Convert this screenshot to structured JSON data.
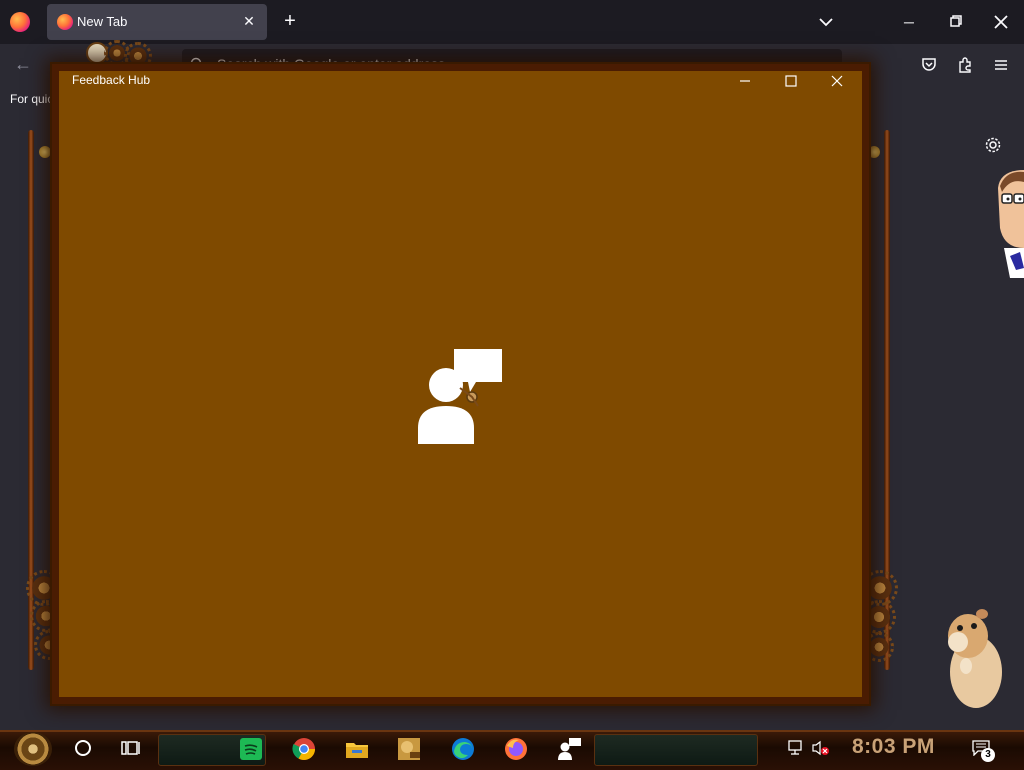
{
  "browser": {
    "tab": {
      "title": "New Tab"
    },
    "url_placeholder": "Search with Google or enter address",
    "bookmarks_hint": "For quic"
  },
  "feedback_hub": {
    "title": "Feedback Hub"
  },
  "taskbar": {
    "clock": "8:03 PM",
    "notification_count": "3",
    "apps": [
      "spotify-icon",
      "chrome-icon",
      "file-explorer-icon",
      "toolbox-icon",
      "edge-icon",
      "firefox-icon",
      "feedback-hub-icon"
    ]
  },
  "colors": {
    "window_bg": "#7f4a00",
    "browser_chrome": "#1c1b22",
    "clock_color": "#c9a277"
  }
}
